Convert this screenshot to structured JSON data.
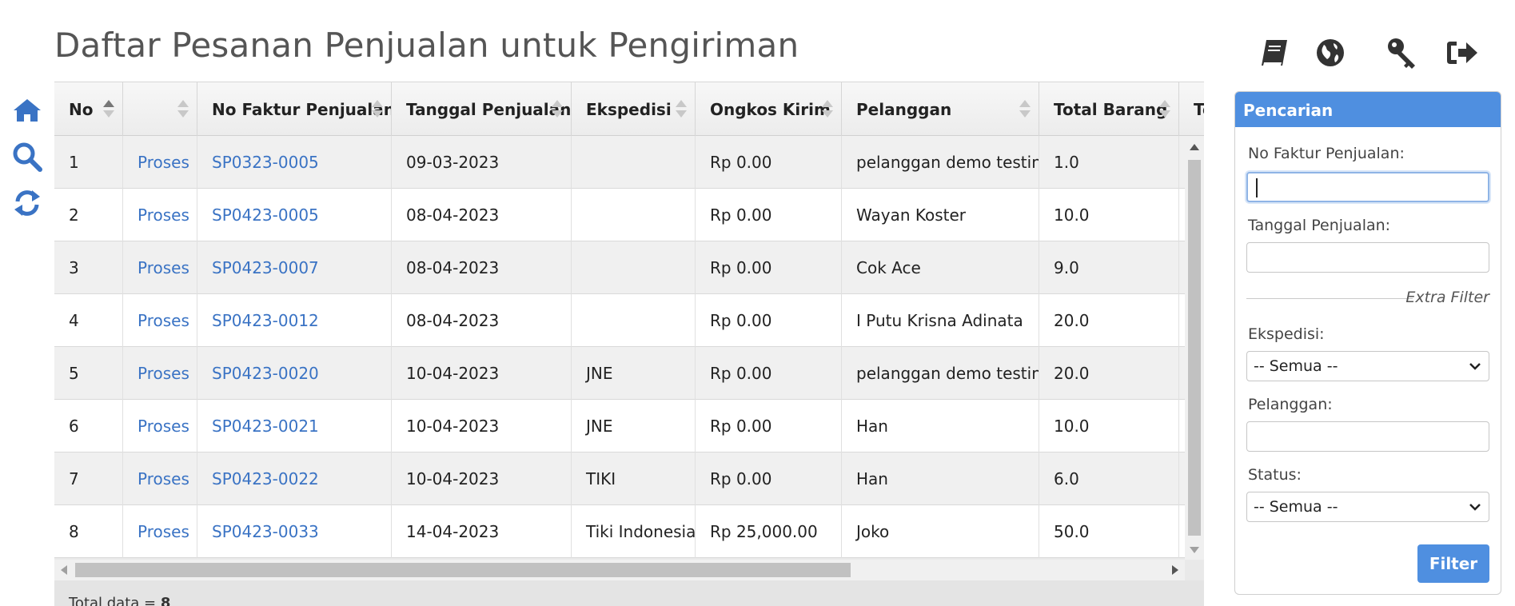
{
  "page": {
    "title": "Daftar Pesanan Penjualan untuk Pengiriman"
  },
  "icons": {
    "left": [
      "home-icon",
      "search-icon",
      "refresh-icon"
    ],
    "top": [
      "book-icon",
      "globe-icon",
      "key-icon",
      "logout-icon"
    ],
    "accent": "#3a73c4",
    "dark": "#333333"
  },
  "table": {
    "columns": [
      "No",
      "",
      "No Faktur Penjualan",
      "Tanggal Penjualan",
      "Ekspedisi",
      "Ongkos Kirim",
      "Pelanggan",
      "Total Barang",
      "To"
    ],
    "rows": [
      {
        "no": "1",
        "action": "Proses",
        "faktur": "SP0323-0005",
        "tanggal": "09-03-2023",
        "ekspedisi": "",
        "ongkos": "Rp 0.00",
        "pelanggan": "pelanggan demo testing",
        "total": "1.0"
      },
      {
        "no": "2",
        "action": "Proses",
        "faktur": "SP0423-0005",
        "tanggal": "08-04-2023",
        "ekspedisi": "",
        "ongkos": "Rp 0.00",
        "pelanggan": "Wayan Koster",
        "total": "10.0"
      },
      {
        "no": "3",
        "action": "Proses",
        "faktur": "SP0423-0007",
        "tanggal": "08-04-2023",
        "ekspedisi": "",
        "ongkos": "Rp 0.00",
        "pelanggan": "Cok Ace",
        "total": "9.0"
      },
      {
        "no": "4",
        "action": "Proses",
        "faktur": "SP0423-0012",
        "tanggal": "08-04-2023",
        "ekspedisi": "",
        "ongkos": "Rp 0.00",
        "pelanggan": "I Putu Krisna Adinata",
        "total": "20.0"
      },
      {
        "no": "5",
        "action": "Proses",
        "faktur": "SP0423-0020",
        "tanggal": "10-04-2023",
        "ekspedisi": "JNE",
        "ongkos": "Rp 0.00",
        "pelanggan": "pelanggan demo testing",
        "total": "20.0"
      },
      {
        "no": "6",
        "action": "Proses",
        "faktur": "SP0423-0021",
        "tanggal": "10-04-2023",
        "ekspedisi": "JNE",
        "ongkos": "Rp 0.00",
        "pelanggan": "Han",
        "total": "10.0"
      },
      {
        "no": "7",
        "action": "Proses",
        "faktur": "SP0423-0022",
        "tanggal": "10-04-2023",
        "ekspedisi": "TIKI",
        "ongkos": "Rp 0.00",
        "pelanggan": "Han",
        "total": "6.0"
      },
      {
        "no": "8",
        "action": "Proses",
        "faktur": "SP0423-0033",
        "tanggal": "14-04-2023",
        "ekspedisi": "Tiki Indonesia",
        "ongkos": "Rp 25,000.00",
        "pelanggan": "Joko",
        "total": "50.0"
      }
    ],
    "footer_label": "Total data = ",
    "footer_count": "8"
  },
  "search_panel": {
    "title": "Pencarian",
    "faktur_label": "No Faktur Penjualan:",
    "faktur_value": "",
    "tanggal_label": "Tanggal Penjualan:",
    "tanggal_value": "",
    "extra_filter": "Extra Filter",
    "ekspedisi_label": "Ekspedisi:",
    "ekspedisi_value": "-- Semua --",
    "pelanggan_label": "Pelanggan:",
    "pelanggan_value": "",
    "status_label": "Status:",
    "status_value": "-- Semua --",
    "filter_button": "Filter"
  }
}
